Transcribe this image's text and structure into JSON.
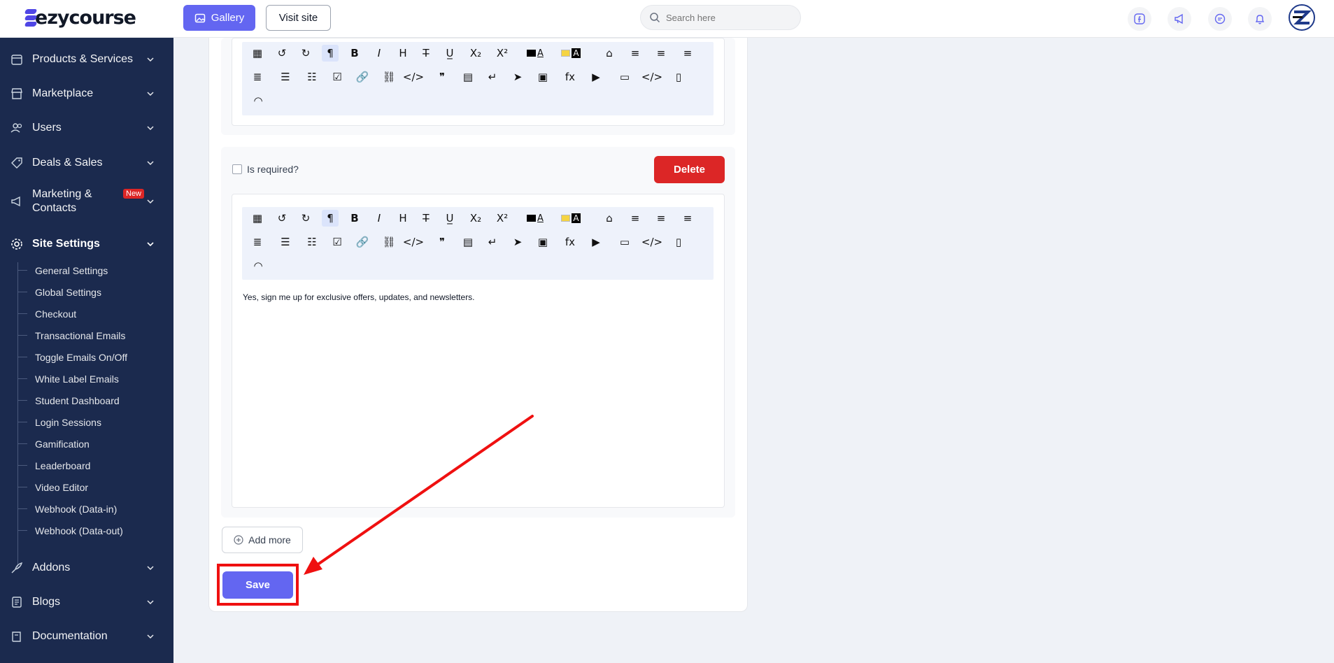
{
  "brand": {
    "name": "ezycourse"
  },
  "header": {
    "gallery_label": "Gallery",
    "visit_site_label": "Visit site",
    "search_placeholder": "Search here"
  },
  "sidebar": {
    "items": [
      {
        "label": "Products & Services"
      },
      {
        "label": "Marketplace"
      },
      {
        "label": "Users"
      },
      {
        "label": "Deals & Sales"
      },
      {
        "label": "Marketing & Contacts",
        "badge": "New"
      },
      {
        "label": "Site Settings"
      },
      {
        "label": "Addons"
      },
      {
        "label": "Blogs"
      },
      {
        "label": "Documentation"
      }
    ],
    "site_settings_sub": [
      "General Settings",
      "Global Settings",
      "Checkout",
      "Transactional Emails",
      "Toggle Emails On/Off",
      "White Label Emails",
      "Student Dashboard",
      "Login Sessions",
      "Gamification",
      "Leaderboard",
      "Video Editor",
      "Webhook (Data-in)",
      "Webhook (Data-out)"
    ]
  },
  "form": {
    "required_label": "Is required?",
    "delete_label": "Delete",
    "editor_text": "Yes, sign me up for exclusive offers, updates, and newsletters.",
    "add_more_label": "Add more",
    "save_label": "Save"
  },
  "colors": {
    "accent": "#6366f1",
    "sidebar_bg": "#1b2a4e",
    "danger": "#dc2626",
    "annotation": "#ef1010"
  }
}
